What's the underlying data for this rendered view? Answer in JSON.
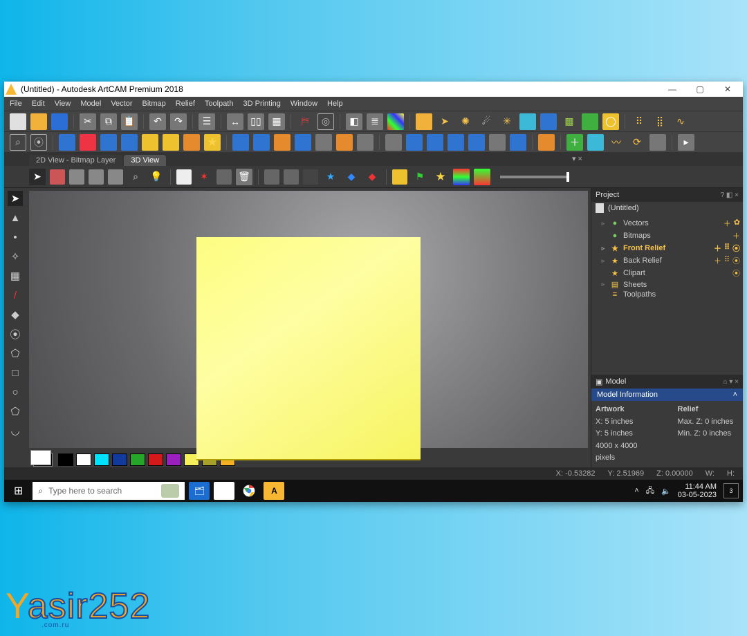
{
  "titlebar": {
    "title": "(Untitled) - Autodesk ArtCAM Premium 2018"
  },
  "menu": [
    "File",
    "Edit",
    "View",
    "Model",
    "Vector",
    "Bitmap",
    "Relief",
    "Toolpath",
    "3D Printing",
    "Window",
    "Help"
  ],
  "tabs": {
    "a": "2D View - Bitmap Layer",
    "b": "3D View"
  },
  "left_tools": [
    "▲",
    "•",
    "✧",
    "▦",
    "/",
    "◆",
    "⦿",
    "⬠",
    "□",
    "○",
    "⬠",
    "◡"
  ],
  "swatches": [
    "#000000",
    "#ffffff",
    "#00e0ff",
    "#103b9c",
    "#25a52a",
    "#d31919",
    "#9b1fbf",
    "#f5ef5a",
    "#a6a12a",
    "#f3b024"
  ],
  "project": {
    "panel_title": "Project",
    "doc": "(Untitled)",
    "tree": [
      {
        "label": "Vectors",
        "icon": "●",
        "tri": "▹",
        "sel": false,
        "rt": [
          "＋",
          "✿"
        ]
      },
      {
        "label": "Bitmaps",
        "icon": "●",
        "tri": "",
        "sel": false,
        "rt": [
          "＋"
        ]
      },
      {
        "label": "Front Relief",
        "icon": "★",
        "tri": "▹",
        "sel": true,
        "rt": [
          "＋",
          "⠿",
          "⦿"
        ]
      },
      {
        "label": "Back Relief",
        "icon": "★",
        "tri": "▹",
        "sel": false,
        "rt": [
          "＋",
          "⠿",
          "⦿"
        ]
      },
      {
        "label": "Clipart",
        "icon": "★",
        "tri": "",
        "sel": false,
        "rt": [
          "⦿"
        ]
      },
      {
        "label": "Sheets",
        "icon": "▤",
        "tri": "▹",
        "sel": false,
        "rt": []
      },
      {
        "label": "Toolpaths",
        "icon": "≡",
        "tri": "",
        "sel": false,
        "rt": []
      }
    ]
  },
  "model": {
    "panel_title": "Model",
    "header": "Model Information",
    "artwork_title": "Artwork",
    "relief_title": "Relief",
    "x": "X: 5 inches",
    "y": "Y: 5 inches",
    "px": "4000 x 4000 pixels",
    "maxz": "Max. Z: 0 inches",
    "minz": "Min. Z: 0 inches"
  },
  "status": {
    "x": "X: -0.53282",
    "y": "Y: 2.51969",
    "z": "Z: 0.00000",
    "w": "W:",
    "h": "H:"
  },
  "taskbar": {
    "search_placeholder": "Type here to search",
    "time": "11:44 AM",
    "date": "03-05-2023",
    "notif_count": "3"
  },
  "watermark": {
    "a": "Y",
    "b": "asir",
    "c": "252",
    "sub": ".com.ru"
  }
}
